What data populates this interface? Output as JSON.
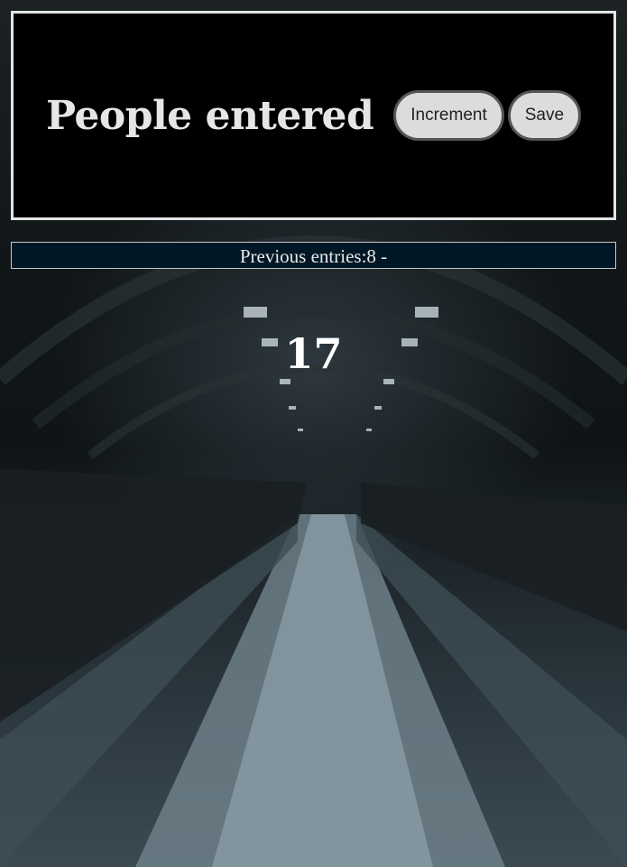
{
  "header": {
    "title": "People entered",
    "increment_label": "Increment",
    "save_label": "Save"
  },
  "previous_entries": {
    "text": "Previous entries:8 -"
  },
  "counter": {
    "value": "17"
  },
  "colors": {
    "header_bg": "#000000",
    "prev_bar_bg": "#001826",
    "button_bg": "#dcdcdc"
  }
}
